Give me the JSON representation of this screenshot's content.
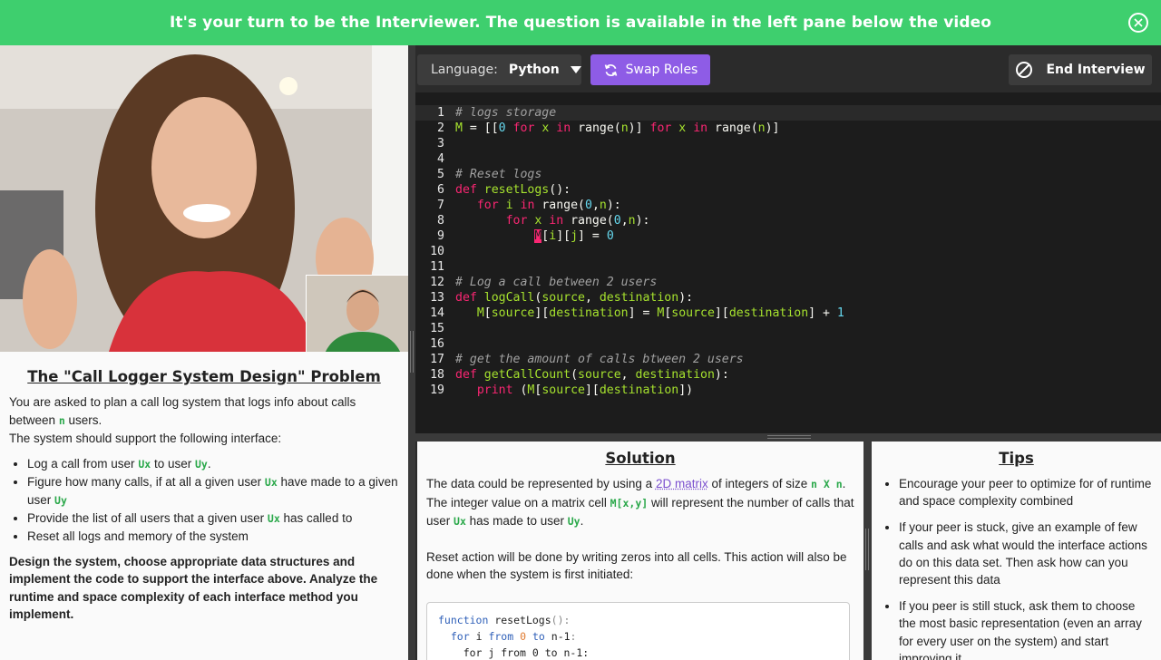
{
  "banner": {
    "text": "It's your turn to be the Interviewer. The question is available in the left pane below the video"
  },
  "toolbar": {
    "language_label": "Language:",
    "language_value": "Python",
    "swap_label": "Swap Roles",
    "end_label": "End Interview"
  },
  "problem": {
    "title": "The \"Call Logger System Design\" Problem",
    "intro_1": "You are asked to plan a call log system that logs info about calls between",
    "intro_var": "n",
    "intro_2": "users.",
    "intro_3": "The system should support the following interface:",
    "bullets": [
      {
        "a": "Log a call from user",
        "v1": "Ux",
        "b": "to user",
        "v2": "Uy",
        "c": "."
      },
      {
        "a": "Figure how many calls, if at all a given user",
        "v1": "Ux",
        "b": "have made to a given user",
        "v2": "Uy",
        "c": ""
      },
      {
        "a": "Provide the list of all users that a given user",
        "v1": "Ux",
        "b": "has called to",
        "v2": "",
        "c": ""
      },
      {
        "a": "Reset all logs and memory of the system",
        "v1": "",
        "b": "",
        "v2": "",
        "c": ""
      }
    ],
    "task": "Design the system, choose appropriate data structures and implement the code to support the interface above. Analyze the runtime and space complexity of each interface method you implement."
  },
  "editor": {
    "line_numbers": [
      "1",
      "2",
      "3",
      "4",
      "5",
      "6",
      "7",
      "8",
      "9",
      "10",
      "11",
      "12",
      "13",
      "14",
      "15",
      "16",
      "17",
      "18",
      "19"
    ],
    "comment_1": "# logs storage",
    "comment_5": "# Reset logs",
    "comment_12": "# Log a call between 2 users",
    "comment_17": "# get the amount of calls btween 2 users",
    "fn_reset": "resetLogs",
    "fn_log": "logCall",
    "fn_get": "getCallCount"
  },
  "solution": {
    "title": "Solution",
    "p1_a": "The data could be represented by using a",
    "p1_link": "2D matrix",
    "p1_b": "of integers of size",
    "p1_code": "n X n",
    "p1_c": ".",
    "p2_a": "The integer value on a matrix cell",
    "p2_code": "M[x,y]",
    "p2_b": "will represent the number of calls that user",
    "p2_v1": "Ux",
    "p2_c": "has made to user",
    "p2_v2": "Uy",
    "p2_d": ".",
    "p3": "Reset action will be done by writing zeros into all cells. This action will also be done when the system is first initiated:",
    "code_line_1": "resetLogs",
    "code_line_2_kw": "for",
    "code_line_2_var": "i",
    "code_line_2_from": "from",
    "code_line_2_n0": "0",
    "code_line_2_to": "to",
    "code_line_2_end": "n-1",
    "code_line_3": "for j from 0 to n-1:"
  },
  "tips": {
    "title": "Tips",
    "items": [
      "Encourage your peer to optimize for of runtime and space complexity combined",
      "If your peer is stuck, give an example of few calls and ask what would the interface actions do on this data set. Then ask how can you represent this data",
      "If you peer is still stuck, ask them to choose the most basic representation (even an array for every user on the system) and start improving it"
    ]
  },
  "colors": {
    "banner": "#3ecf6e",
    "swap": "#8e5ce6",
    "editor_bg": "#1c1c1c",
    "keyword": "#f92672",
    "function": "#a6e22e",
    "number": "#66d9ef"
  }
}
